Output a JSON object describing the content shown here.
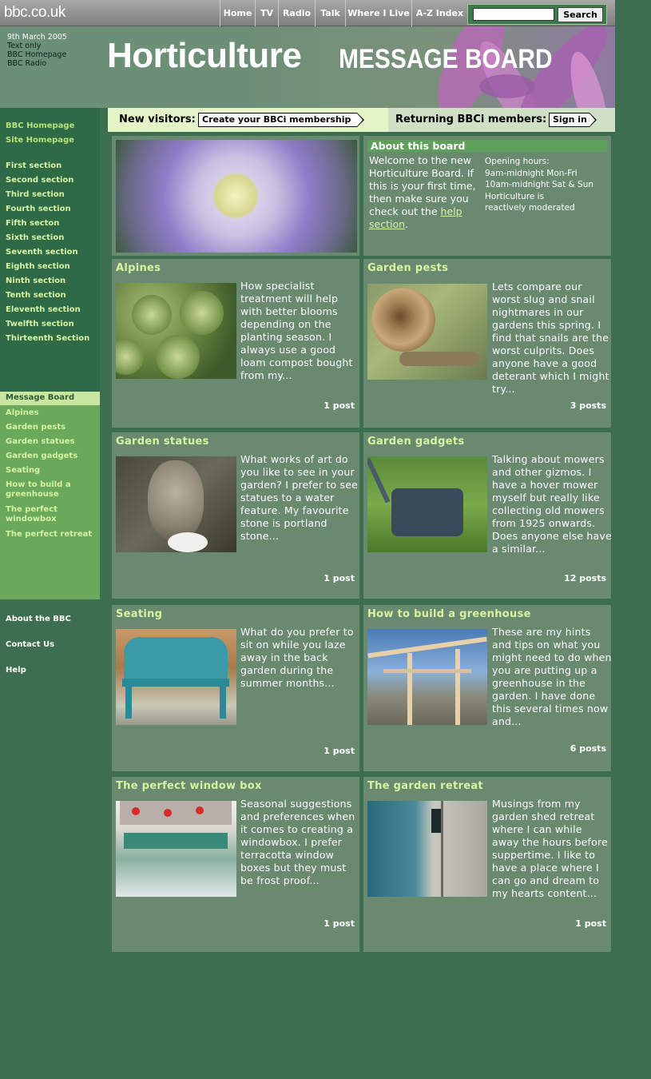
{
  "top": {
    "logo": "bbc.co.uk",
    "nav": [
      "Home",
      "TV",
      "Radio",
      "Talk",
      "Where I Live",
      "A-Z Index"
    ],
    "search_button": "Search"
  },
  "banner": {
    "date": "9th March 2005",
    "links": [
      "Text only",
      "BBC Homepage",
      "BBC Radio"
    ],
    "title": "Horticulture",
    "subtitle": "MESSAGE BOARD"
  },
  "leftnav": {
    "top_links": [
      "BBC Homepage",
      "Site Homepage"
    ],
    "sections": [
      "First section",
      "Second section",
      "Third section",
      "Fourth section",
      "Fifth secton",
      "Sixth section",
      "Seventh section",
      "Eighth section",
      "Ninth section",
      "Tenth section",
      "Eleventh section",
      "Twelfth section",
      "Thirteenth Section"
    ],
    "board_header": "Message Board",
    "boards": [
      "Alpines",
      "Garden pests",
      "Garden statues",
      "Garden gadgets",
      "Seating",
      "How to build a greenhouse",
      "The perfect windowbox",
      "The perfect retreat"
    ],
    "footer_links": [
      "About the BBC",
      "Contact Us",
      "Help"
    ]
  },
  "membership": {
    "new_label": "New visitors:",
    "new_button": "Create your BBCi membership",
    "returning_label": "Returning BBCi members:",
    "returning_button": "Sign in"
  },
  "about": {
    "header": "About this board",
    "text": "Welcome to the new Horticulture Board. If this is your first time, then make sure you check out the",
    "link": "help section",
    "after_link": ".",
    "hours": [
      "Opening hours:",
      "9am-midnight Mon-Fri",
      "10am-midnight Sat & Sun",
      "Horticulture is",
      "reactively moderated"
    ]
  },
  "boards": [
    {
      "title": "Alpines",
      "text": "How specialist treatment will help with better blooms depending on the planting season. I always use a good loam compost bought from my...",
      "posts": "1 post"
    },
    {
      "title": "Garden pests",
      "text": "Lets compare our worst slug and snail nightmares in our gardens this spring. I find that snails are the worst culprits. Does anyone have a good deterant which I might try...",
      "posts": "3 posts"
    },
    {
      "title": "Garden statues",
      "text": "What works of art do you like to see in your garden? I prefer to see statues to a water feature. My favourite stone is portland stone...",
      "posts": "1 post"
    },
    {
      "title": "Garden gadgets",
      "text": "Talking about mowers and other gizmos. I have a hover mower myself but really like collecting old mowers from 1925 onwards. Does anyone else have a similar...",
      "posts": "12 posts"
    },
    {
      "title": "Seating",
      "text": "What do you prefer to sit on while you laze away in the back garden during the summer months...",
      "posts": "1 post"
    },
    {
      "title": "How to build a greenhouse",
      "text": "These are my hints and tips on what you might need to do when you are putting up a greenhouse in the garden. I have done this several times now and...",
      "posts": "6 posts"
    },
    {
      "title": "The perfect window box",
      "text": "Seasonal suggestions and preferences when it comes to creating a windowbox. I prefer terracotta window boxes but they must be frost proof...",
      "posts": "1 post"
    },
    {
      "title": "The garden retreat",
      "text": "Musings from my garden shed retreat where I can while away the hours before suppertime. I like to have a place where I can go and dream to my hearts content...",
      "posts": "1 post"
    }
  ]
}
